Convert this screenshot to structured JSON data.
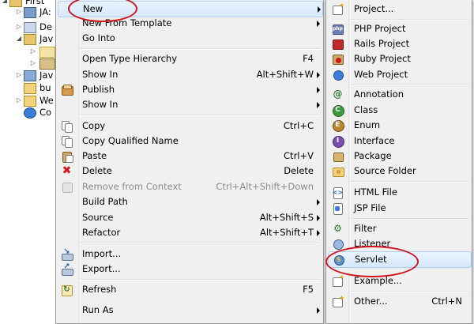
{
  "tree": {
    "items": [
      {
        "label": "First",
        "indent": 0
      },
      {
        "label": "JA:",
        "indent": 1
      },
      {
        "label": "De",
        "indent": 1
      },
      {
        "label": "Jav",
        "indent": 1
      },
      {
        "label": "",
        "indent": 2
      },
      {
        "label": "",
        "indent": 2
      },
      {
        "label": "Jav",
        "indent": 1
      },
      {
        "label": "bu",
        "indent": 1
      },
      {
        "label": "We",
        "indent": 1
      },
      {
        "label": "Co",
        "indent": 1
      }
    ]
  },
  "context_menu": {
    "items": [
      {
        "label": "New",
        "shortcut": "",
        "submenu": true,
        "icon": "none"
      },
      {
        "label": "New From Template",
        "shortcut": "",
        "submenu": true,
        "icon": "none"
      },
      {
        "label": "Go Into",
        "shortcut": "",
        "submenu": false,
        "icon": "none"
      },
      {
        "label": "Open Type Hierarchy",
        "shortcut": "F4",
        "submenu": false,
        "icon": "none"
      },
      {
        "label": "Show In",
        "shortcut": "Alt+Shift+W",
        "submenu": true,
        "icon": "none"
      },
      {
        "label": "Publish",
        "shortcut": "",
        "submenu": true,
        "icon": "publish-icon"
      },
      {
        "label": "Show In",
        "shortcut": "",
        "submenu": true,
        "icon": "none"
      },
      {
        "label": "Copy",
        "shortcut": "Ctrl+C",
        "submenu": false,
        "icon": "copy-icon"
      },
      {
        "label": "Copy Qualified Name",
        "shortcut": "",
        "submenu": false,
        "icon": "copy-icon"
      },
      {
        "label": "Paste",
        "shortcut": "Ctrl+V",
        "submenu": false,
        "icon": "paste-icon"
      },
      {
        "label": "Delete",
        "shortcut": "Delete",
        "submenu": false,
        "icon": "delete-icon"
      },
      {
        "label": "Remove from Context",
        "shortcut": "Ctrl+Alt+Shift+Down",
        "submenu": false,
        "disabled": true,
        "icon": "remove-context-icon"
      },
      {
        "label": "Build Path",
        "shortcut": "",
        "submenu": true,
        "icon": "none"
      },
      {
        "label": "Source",
        "shortcut": "Alt+Shift+S",
        "submenu": true,
        "icon": "none"
      },
      {
        "label": "Refactor",
        "shortcut": "Alt+Shift+T",
        "submenu": true,
        "icon": "none"
      },
      {
        "label": "Import...",
        "shortcut": "",
        "submenu": false,
        "icon": "import-icon"
      },
      {
        "label": "Export...",
        "shortcut": "",
        "submenu": false,
        "icon": "export-icon"
      },
      {
        "label": "Refresh",
        "shortcut": "F5",
        "submenu": false,
        "icon": "refresh-icon"
      },
      {
        "label": "Run As",
        "shortcut": "",
        "submenu": true,
        "icon": "none"
      }
    ]
  },
  "new_submenu": {
    "items": [
      {
        "label": "Project...",
        "shortcut": "",
        "icon": "new-project-icon"
      },
      {
        "label": "PHP Project",
        "shortcut": "",
        "icon": "php-project-icon"
      },
      {
        "label": "Rails Project",
        "shortcut": "",
        "icon": "rails-project-icon"
      },
      {
        "label": "Ruby Project",
        "shortcut": "",
        "icon": "ruby-project-icon"
      },
      {
        "label": "Web Project",
        "shortcut": "",
        "icon": "web-project-icon"
      },
      {
        "label": "Annotation",
        "shortcut": "",
        "icon": "annotation-icon"
      },
      {
        "label": "Class",
        "shortcut": "",
        "icon": "class-icon"
      },
      {
        "label": "Enum",
        "shortcut": "",
        "icon": "enum-icon"
      },
      {
        "label": "Interface",
        "shortcut": "",
        "icon": "interface-icon"
      },
      {
        "label": "Package",
        "shortcut": "",
        "icon": "package-icon"
      },
      {
        "label": "Source Folder",
        "shortcut": "",
        "icon": "source-folder-icon"
      },
      {
        "label": "HTML File",
        "shortcut": "",
        "icon": "html-file-icon"
      },
      {
        "label": "JSP File",
        "shortcut": "",
        "icon": "jsp-file-icon"
      },
      {
        "label": "Filter",
        "shortcut": "",
        "icon": "filter-icon"
      },
      {
        "label": "Listener",
        "shortcut": "",
        "icon": "listener-icon"
      },
      {
        "label": "Servlet",
        "shortcut": "",
        "icon": "servlet-icon"
      },
      {
        "label": "Example...",
        "shortcut": "",
        "icon": "example-icon"
      },
      {
        "label": "Other...",
        "shortcut": "Ctrl+N",
        "icon": "other-icon"
      }
    ]
  },
  "colors": {
    "menu_bg": "#f0f0f0",
    "highlight": "#d6e8fc",
    "annotation": "#d0121b"
  }
}
